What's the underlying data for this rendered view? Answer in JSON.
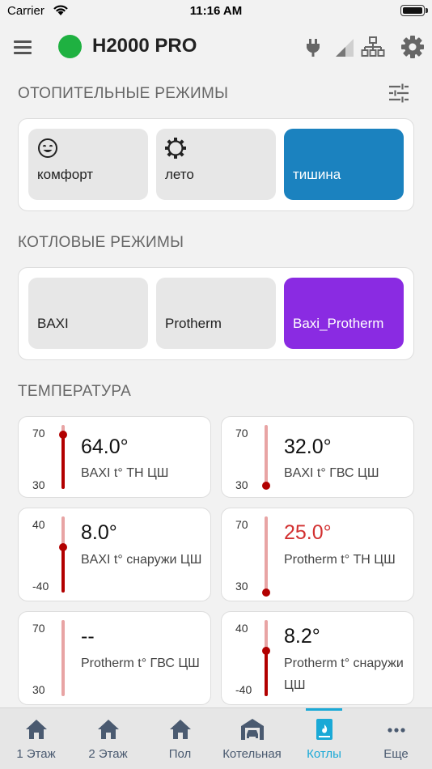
{
  "status": {
    "carrier": "Carrier",
    "time": "11:16 AM"
  },
  "header": {
    "title": "H2000 PRO",
    "online_color": "#1fb141"
  },
  "heating": {
    "title": "ОТОПИТЕЛЬНЫЕ РЕЖИМЫ",
    "modes": [
      {
        "label": "комфорт",
        "icon": "smile-icon",
        "active": false
      },
      {
        "label": "лето",
        "icon": "sun-icon",
        "active": false
      },
      {
        "label": "тишина",
        "active": true,
        "color": "#1b82bf"
      }
    ]
  },
  "boiler": {
    "title": "КОТЛОВЫЕ РЕЖИМЫ",
    "modes": [
      {
        "label": "BAXI",
        "active": false
      },
      {
        "label": "Protherm",
        "active": false
      },
      {
        "label": "Baxi_Protherm",
        "active": true,
        "color": "#8a2be2"
      }
    ]
  },
  "temperature": {
    "title": "ТЕМПЕРАТУРА",
    "sensors": [
      {
        "max": "70",
        "min": "30",
        "value": "64.0°",
        "level": 0.85,
        "name": "BAXI t° ТН ЦШ"
      },
      {
        "max": "70",
        "min": "30",
        "value": "32.0°",
        "level": 0.05,
        "name": "BAXI t° ГВС ЦШ"
      },
      {
        "max": "40",
        "min": "-40",
        "value": "8.0°",
        "level": 0.6,
        "name": "BAXI t° снаружи ЦШ"
      },
      {
        "max": "70",
        "min": "30",
        "value": "25.0°",
        "level": 0.0,
        "name": "Protherm t° ТН ЦШ",
        "value_color": "#d23030"
      },
      {
        "max": "70",
        "min": "30",
        "value": "--",
        "level": null,
        "name": "Protherm t° ГВС ЦШ"
      },
      {
        "max": "40",
        "min": "-40",
        "value": "8.2°",
        "level": 0.6,
        "name": "Protherm t° снаружи ЦШ"
      }
    ]
  },
  "tabs": [
    {
      "label": "1 Этаж",
      "icon": "home-icon",
      "active": false
    },
    {
      "label": "2 Этаж",
      "icon": "home-icon",
      "active": false
    },
    {
      "label": "Пол",
      "icon": "home-icon",
      "active": false
    },
    {
      "label": "Котельная",
      "icon": "garage-icon",
      "active": false
    },
    {
      "label": "Котлы",
      "icon": "boiler-icon",
      "active": true
    },
    {
      "label": "Еще",
      "icon": "more-icon",
      "active": false
    }
  ],
  "colors": {
    "accent": "#1aa9d6",
    "thermo_fill": "#b20000",
    "thermo_track": "#e8a4a4"
  }
}
